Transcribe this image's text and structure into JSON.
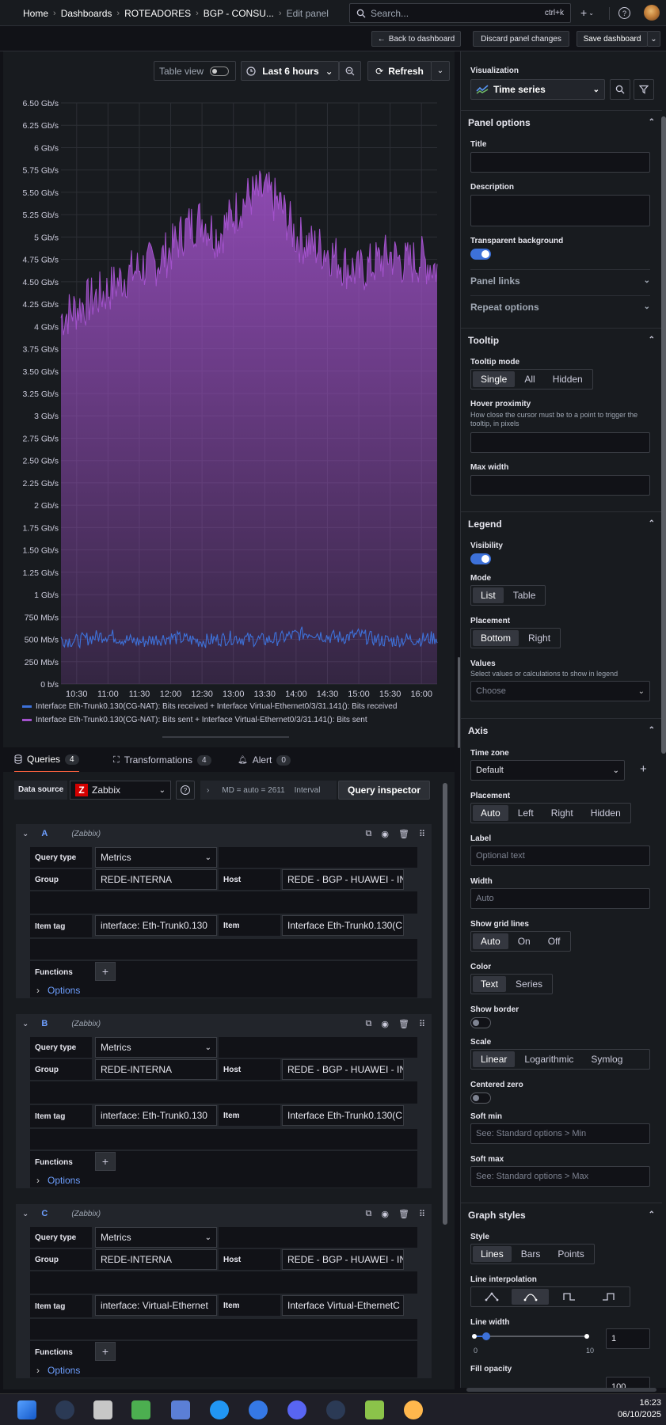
{
  "topbar": {
    "breadcrumbs": [
      "Home",
      "Dashboards",
      "ROTEADORES",
      "BGP - CONSU...",
      "Edit panel"
    ],
    "search_placeholder": "Search...",
    "search_shortcut": "ctrl+k"
  },
  "subbar": {
    "back": "Back to dashboard",
    "discard": "Discard panel changes",
    "save": "Save dashboard"
  },
  "panel_toolbar": {
    "table_view": "Table view",
    "time_range": "Last 6 hours",
    "refresh": "Refresh"
  },
  "chart_data": {
    "type": "area",
    "ylabel_ticks": [
      "6.50 Gb/s",
      "6.25 Gb/s",
      "6 Gb/s",
      "5.75 Gb/s",
      "5.50 Gb/s",
      "5.25 Gb/s",
      "5 Gb/s",
      "4.75 Gb/s",
      "4.50 Gb/s",
      "4.25 Gb/s",
      "4 Gb/s",
      "3.75 Gb/s",
      "3.50 Gb/s",
      "3.25 Gb/s",
      "3 Gb/s",
      "2.75 Gb/s",
      "2.50 Gb/s",
      "2.25 Gb/s",
      "2 Gb/s",
      "1.75 Gb/s",
      "1.50 Gb/s",
      "1.25 Gb/s",
      "1 Gb/s",
      "750 Mb/s",
      "500 Mb/s",
      "250 Mb/s",
      "0 b/s"
    ],
    "x_ticks": [
      "10:30",
      "11:00",
      "11:30",
      "12:00",
      "12:30",
      "13:00",
      "13:30",
      "14:00",
      "14:30",
      "15:00",
      "15:30",
      "16:00"
    ],
    "ylim_gbps": [
      0,
      6.5
    ],
    "x": [
      "10:15",
      "10:30",
      "10:45",
      "11:00",
      "11:15",
      "11:30",
      "11:45",
      "12:00",
      "12:15",
      "12:30",
      "12:45",
      "13:00",
      "13:15",
      "13:30",
      "13:45",
      "14:00",
      "14:15",
      "14:30",
      "14:45",
      "15:00",
      "15:15",
      "15:30",
      "15:45",
      "16:00",
      "16:15"
    ],
    "series": [
      {
        "name": "Interface Eth-Trunk0.130(CG-NAT): Bits received + Interface Virtual-Ethernet0/3/31.141(): Bits received",
        "color": "#3d71d9",
        "values": [
          0.5,
          0.48,
          0.52,
          0.55,
          0.5,
          0.47,
          0.5,
          0.52,
          0.5,
          0.48,
          0.5,
          0.52,
          0.5,
          0.49,
          0.51,
          0.55,
          0.58,
          0.53,
          0.52,
          0.55,
          0.5,
          0.48,
          0.5,
          0.5,
          0.52
        ]
      },
      {
        "name": "Interface Eth-Trunk0.130(CG-NAT): Bits sent + Interface Virtual-Ethernet0/3/31.141(): Bits sent",
        "color": "#a352cc",
        "values": [
          4.1,
          4.2,
          4.3,
          4.4,
          4.55,
          4.65,
          4.7,
          4.85,
          5.1,
          5.2,
          5.0,
          5.25,
          5.45,
          5.5,
          5.35,
          5.0,
          4.9,
          4.85,
          4.7,
          4.6,
          4.7,
          4.8,
          4.7,
          4.75,
          4.65
        ]
      }
    ],
    "legend_placement": "bottom"
  },
  "editor": {
    "tabs": [
      {
        "label": "Queries",
        "count": "4"
      },
      {
        "label": "Transformations",
        "count": "4"
      },
      {
        "label": "Alert",
        "count": "0"
      }
    ],
    "datasource_label": "Data source",
    "datasource": "Zabbix",
    "interval_text": "MD = auto = 2611",
    "interval_label": "Interval",
    "query_inspector": "Query inspector",
    "queries": [
      {
        "id": "A",
        "source": "(Zabbix)",
        "query_type": "Metrics",
        "group": "REDE-INTERNA",
        "host": "REDE - BGP - HUAWEI - IN",
        "item_tag": "interface: Eth-Trunk0.130",
        "item": "Interface Eth-Trunk0.130(C"
      },
      {
        "id": "B",
        "source": "(Zabbix)",
        "query_type": "Metrics",
        "group": "REDE-INTERNA",
        "host": "REDE - BGP - HUAWEI - IN",
        "item_tag": "interface: Eth-Trunk0.130",
        "item": "Interface Eth-Trunk0.130(C"
      },
      {
        "id": "C",
        "source": "(Zabbix)",
        "query_type": "Metrics",
        "group": "REDE-INTERNA",
        "host": "REDE - BGP - HUAWEI - IN",
        "item_tag": "interface: Virtual-Ethernet",
        "item": "Interface Virtual-EthernetC"
      }
    ],
    "labels": {
      "query_type": "Query type",
      "group": "Group",
      "host": "Host",
      "item_tag": "Item tag",
      "item": "Item",
      "functions": "Functions",
      "options": "Options"
    }
  },
  "options_pane": {
    "visualization_label": "Visualization",
    "visualization": "Time series",
    "panel_options": "Panel options",
    "title_label": "Title",
    "description_label": "Description",
    "transparent_label": "Transparent background",
    "panel_links": "Panel links",
    "repeat_options": "Repeat options",
    "tooltip": "Tooltip",
    "tooltip_mode_label": "Tooltip mode",
    "tooltip_modes": [
      "Single",
      "All",
      "Hidden"
    ],
    "hover_label": "Hover proximity",
    "hover_desc": "How close the cursor must be to a point to trigger the tooltip, in pixels",
    "max_width_label": "Max width",
    "legend": "Legend",
    "visibility_label": "Visibility",
    "mode_label": "Mode",
    "legend_modes": [
      "List",
      "Table"
    ],
    "placement_label": "Placement",
    "legend_placements": [
      "Bottom",
      "Right"
    ],
    "values_label": "Values",
    "values_desc": "Select values or calculations to show in legend",
    "values_placeholder": "Choose",
    "axis": "Axis",
    "timezone_label": "Time zone",
    "timezone": "Default",
    "axis_placement_label": "Placement",
    "axis_placements": [
      "Auto",
      "Left",
      "Right",
      "Hidden"
    ],
    "label_label": "Label",
    "label_placeholder": "Optional text",
    "width_label": "Width",
    "width_placeholder": "Auto",
    "grid_label": "Show grid lines",
    "grid_options": [
      "Auto",
      "On",
      "Off"
    ],
    "color_label": "Color",
    "color_options": [
      "Text",
      "Series"
    ],
    "border_label": "Show border",
    "scale_label": "Scale",
    "scale_options": [
      "Linear",
      "Logarithmic",
      "Symlog"
    ],
    "centered_label": "Centered zero",
    "soft_min_label": "Soft min",
    "soft_min_placeholder": "See: Standard options > Min",
    "soft_max_label": "Soft max",
    "soft_max_placeholder": "See: Standard options > Max",
    "graph_styles": "Graph styles",
    "style_label": "Style",
    "style_options": [
      "Lines",
      "Bars",
      "Points"
    ],
    "interp_label": "Line interpolation",
    "line_width_label": "Line width",
    "line_width_value": "1",
    "line_width_min": "0",
    "line_width_max": "10",
    "line_width_fraction": 0.1,
    "fill_opacity_label": "Fill opacity",
    "fill_opacity_value": "100"
  },
  "taskbar": {
    "time": "16:23",
    "date": "06/10/2025"
  }
}
